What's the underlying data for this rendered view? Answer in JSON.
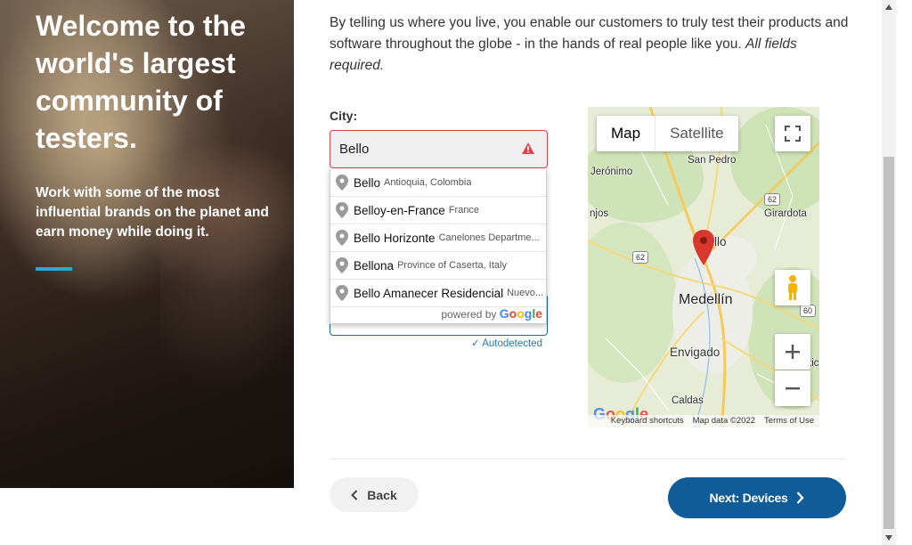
{
  "hero": {
    "title": "Welcome to the world's largest community of testers.",
    "subtitle": "Work with some of the most influential brands on the planet and earn money while doing it."
  },
  "intro": {
    "text": "By telling us where you live, you enable our customers to truly test their products and software throughout the globe - in the hands of real people like you.",
    "note": "All fields required."
  },
  "city": {
    "label": "City:",
    "value": "Bello"
  },
  "autocomplete": {
    "items": [
      {
        "match": "Bello",
        "rest": "",
        "secondary": "Antioquia, Colombia"
      },
      {
        "match": "Bello",
        "rest": "y-en-France",
        "secondary": "France"
      },
      {
        "match": "Bello",
        "rest": " Horizonte",
        "secondary": "Canelones Departme..."
      },
      {
        "match": "Bello",
        "rest": "na",
        "secondary": "Province of Caserta, Italy"
      },
      {
        "match": "Bello",
        "rest": " Amanecer Residencial",
        "secondary": "Nuevo..."
      }
    ],
    "powered_by": "powered by",
    "google": [
      "G",
      "o",
      "o",
      "g",
      "l",
      "e"
    ]
  },
  "autodetected": "✓ Autodetected",
  "map": {
    "tabs": [
      "Map",
      "Satellite"
    ],
    "labels": {
      "jeronimo": "Jerónimo",
      "san_pedro": "San Pedro",
      "girardota": "Girardota",
      "njos": "njos",
      "bello_partial": "llo",
      "medellin": "Medellín",
      "envigado": "Envigado",
      "caldas": "Caldas",
      "tic": "tic"
    },
    "shields": [
      "62",
      "62",
      "60"
    ],
    "footer": [
      "Keyboard shortcuts",
      "Map data ©2022",
      "Terms of Use"
    ],
    "google_logo": "Google"
  },
  "buttons": {
    "back": "Back",
    "next": "Next: Devices"
  },
  "colors": {
    "primary": "#0f5c98",
    "accent": "#2aa8d4",
    "error": "#e0434b",
    "pin": "#d9382e"
  }
}
